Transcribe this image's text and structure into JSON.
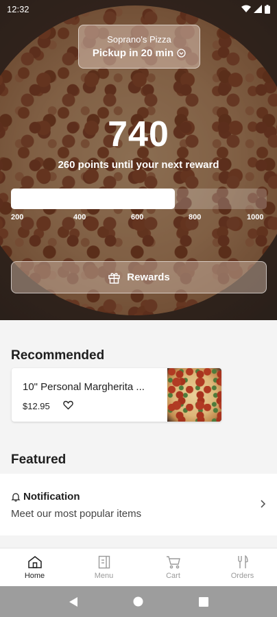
{
  "status_bar": {
    "time": "12:32"
  },
  "store": {
    "name": "Soprano's Pizza",
    "pickup": "Pickup in 20 min"
  },
  "points": {
    "value": "740",
    "subtitle": "260 points until your next reward",
    "progress_fraction": 0.64
  },
  "progress_ticks": [
    "200",
    "400",
    "600",
    "800",
    "1000"
  ],
  "rewards_button": {
    "label": "Rewards"
  },
  "recommended": {
    "title": "Recommended",
    "item": {
      "name": "10\" Personal Margherita ...",
      "price": "$12.95"
    }
  },
  "featured": {
    "title": "Featured",
    "notification_title": "Notification",
    "notification_subtitle": "Meet our most popular items"
  },
  "nav": [
    {
      "label": "Home",
      "icon": "home-icon",
      "active": true
    },
    {
      "label": "Menu",
      "icon": "menu-icon",
      "active": false
    },
    {
      "label": "Cart",
      "icon": "cart-icon",
      "active": false
    },
    {
      "label": "Orders",
      "icon": "orders-icon",
      "active": false
    }
  ],
  "colors": {
    "accent": "#1e1e1e",
    "inactive": "#9a9a9a",
    "system_nav": "#9d9d9d"
  }
}
